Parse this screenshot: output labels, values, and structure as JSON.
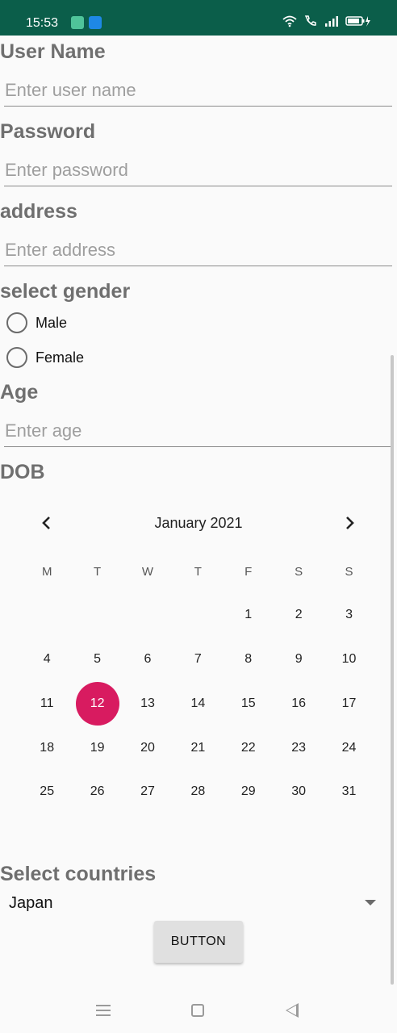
{
  "status_bar": {
    "time": "15:53",
    "icons": [
      "app-icon",
      "usb-icon",
      "wifi-icon",
      "volte-call-icon",
      "signal-icon",
      "battery-charging-icon"
    ]
  },
  "form": {
    "username": {
      "label": "User Name",
      "placeholder": "Enter user name"
    },
    "password": {
      "label": "Password",
      "placeholder": "Enter password"
    },
    "address": {
      "label": "address",
      "placeholder": "Enter address"
    },
    "gender": {
      "label": "select gender",
      "options": [
        "Male",
        "Female"
      ]
    },
    "age": {
      "label": "Age",
      "placeholder": "Enter age"
    },
    "dob": {
      "label": "DOB"
    }
  },
  "calendar": {
    "month_title": "January 2021",
    "weekdays": [
      "M",
      "T",
      "W",
      "T",
      "F",
      "S",
      "S"
    ],
    "weeks": [
      [
        "",
        "",
        "",
        "",
        "1",
        "2",
        "3"
      ],
      [
        "4",
        "5",
        "6",
        "7",
        "8",
        "9",
        "10"
      ],
      [
        "11",
        "12",
        "13",
        "14",
        "15",
        "16",
        "17"
      ],
      [
        "18",
        "19",
        "20",
        "21",
        "22",
        "23",
        "24"
      ],
      [
        "25",
        "26",
        "27",
        "28",
        "29",
        "30",
        "31"
      ]
    ],
    "selected_day": "12",
    "accent_color": "#d81b60"
  },
  "countries": {
    "label": "Select countries",
    "selected": "Japan"
  },
  "button": {
    "label": "BUTTON"
  },
  "theme": {
    "status_bar_color": "#0b5e4a"
  }
}
